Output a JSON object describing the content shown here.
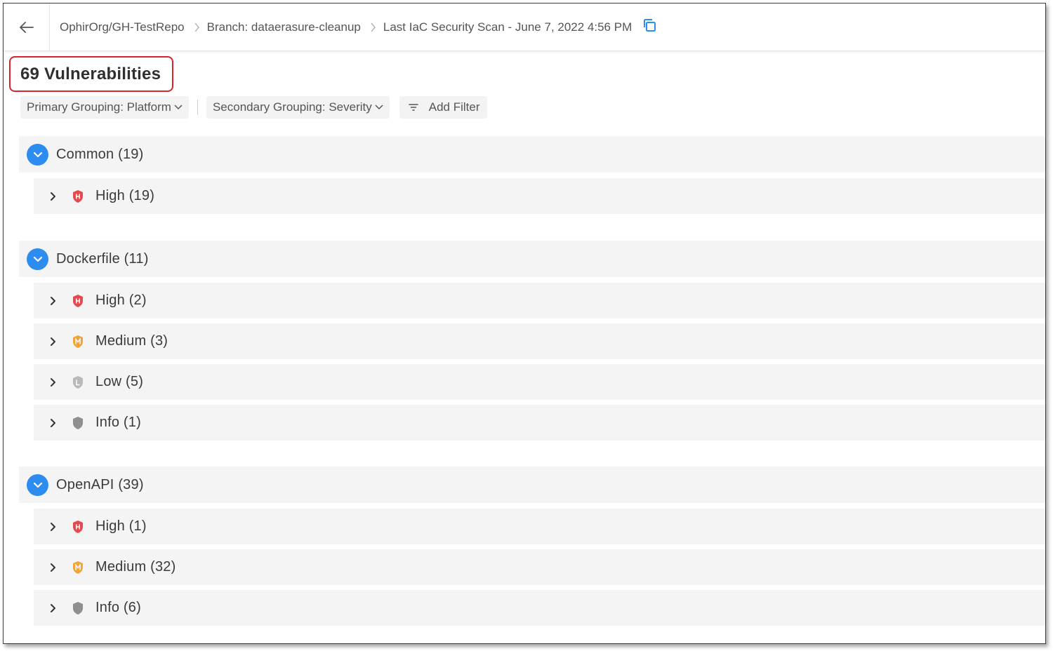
{
  "header": {
    "breadcrumbs": [
      {
        "label": "OphirOrg/GH-TestRepo"
      },
      {
        "label": "Branch: dataerasure-cleanup"
      },
      {
        "label": "Last IaC Security Scan - June 7, 2022 4:56 PM"
      }
    ]
  },
  "title": "69 Vulnerabilities",
  "toolbar": {
    "primary_grouping": "Primary Grouping: Platform",
    "secondary_grouping": "Secondary Grouping: Severity",
    "add_filter": "Add Filter"
  },
  "groups": [
    {
      "label": "Common (19)",
      "items": [
        {
          "label": "High (19)",
          "severity": "high"
        }
      ]
    },
    {
      "label": "Dockerfile (11)",
      "items": [
        {
          "label": "High (2)",
          "severity": "high"
        },
        {
          "label": "Medium (3)",
          "severity": "medium"
        },
        {
          "label": "Low (5)",
          "severity": "low"
        },
        {
          "label": "Info (1)",
          "severity": "info"
        }
      ]
    },
    {
      "label": "OpenAPI (39)",
      "items": [
        {
          "label": "High (1)",
          "severity": "high"
        },
        {
          "label": "Medium (32)",
          "severity": "medium"
        },
        {
          "label": "Info (6)",
          "severity": "info"
        }
      ]
    }
  ],
  "colors": {
    "accent": "#2d8cf0",
    "highlight_border": "#d9232a",
    "severity_high": "#e5484d",
    "severity_medium": "#f2a33a",
    "severity_low": "#b9b9b9",
    "severity_info": "#8f8f8f"
  }
}
